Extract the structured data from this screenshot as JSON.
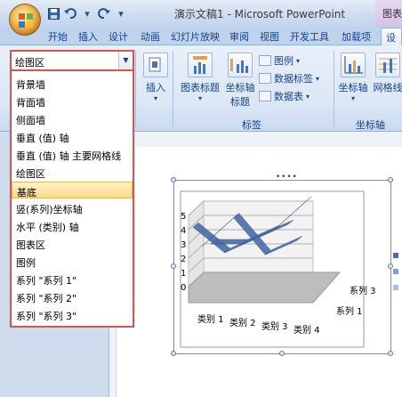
{
  "window": {
    "title": "演示文稿1 - Microsoft PowerPoint",
    "context_tab": "图表"
  },
  "quick_access": {
    "save_icon": "save-icon",
    "undo_icon": "undo-icon",
    "redo_icon": "redo-icon"
  },
  "ribbon_tabs": [
    {
      "label": "开始"
    },
    {
      "label": "插入"
    },
    {
      "label": "设计"
    },
    {
      "label": "动画"
    },
    {
      "label": "幻灯片放映"
    },
    {
      "label": "审阅"
    },
    {
      "label": "视图"
    },
    {
      "label": "开发工具"
    },
    {
      "label": "加载项"
    },
    {
      "label": "设计"
    }
  ],
  "ribbon": {
    "insert_label": "插入",
    "chart_title_label": "图表标题",
    "axis_title_label": "坐标轴",
    "axis_title_label2": "标题",
    "legend_label": "图例",
    "data_labels_label": "数据标签",
    "data_table_label": "数据表",
    "group_labels": "标签",
    "axes_label": "坐标轴",
    "gridlines_label": "网格线",
    "group_axes": "坐标轴"
  },
  "element_selector": {
    "current_value": "绘图区",
    "options": [
      "背景墙",
      "背面墙",
      "侧面墙",
      "垂直 (值) 轴",
      "垂直 (值) 轴 主要网格线",
      "绘图区",
      "基底",
      "竖(系列)坐标轴",
      "水平 (类别) 轴",
      "图表区",
      "图例",
      "系列 \"系列 1\"",
      "系列 \"系列 2\"",
      "系列 \"系列 3\""
    ],
    "highlighted": "基底"
  },
  "chart_data": {
    "type": "line",
    "categories": [
      "类别 1",
      "类别 2",
      "类别 3",
      "类别 4"
    ],
    "depth_labels": [
      "系列 3"
    ],
    "depth_label_front": "系列 1",
    "y_ticks": [
      "0",
      "1",
      "2",
      "3",
      "4",
      "5"
    ],
    "ylim": [
      0,
      5
    ],
    "series": [
      {
        "values": [
          4.3,
          2.5,
          3.5,
          4.5
        ],
        "color": "#4a6ea8"
      },
      {
        "values": [
          2.4,
          4.4,
          1.8,
          2.8
        ],
        "color": "#4a6ea8"
      },
      {
        "values": [
          2.0,
          2.0,
          3.0,
          5.0
        ],
        "color": "#4a6ea8"
      }
    ],
    "grid": true,
    "legend": "right"
  }
}
